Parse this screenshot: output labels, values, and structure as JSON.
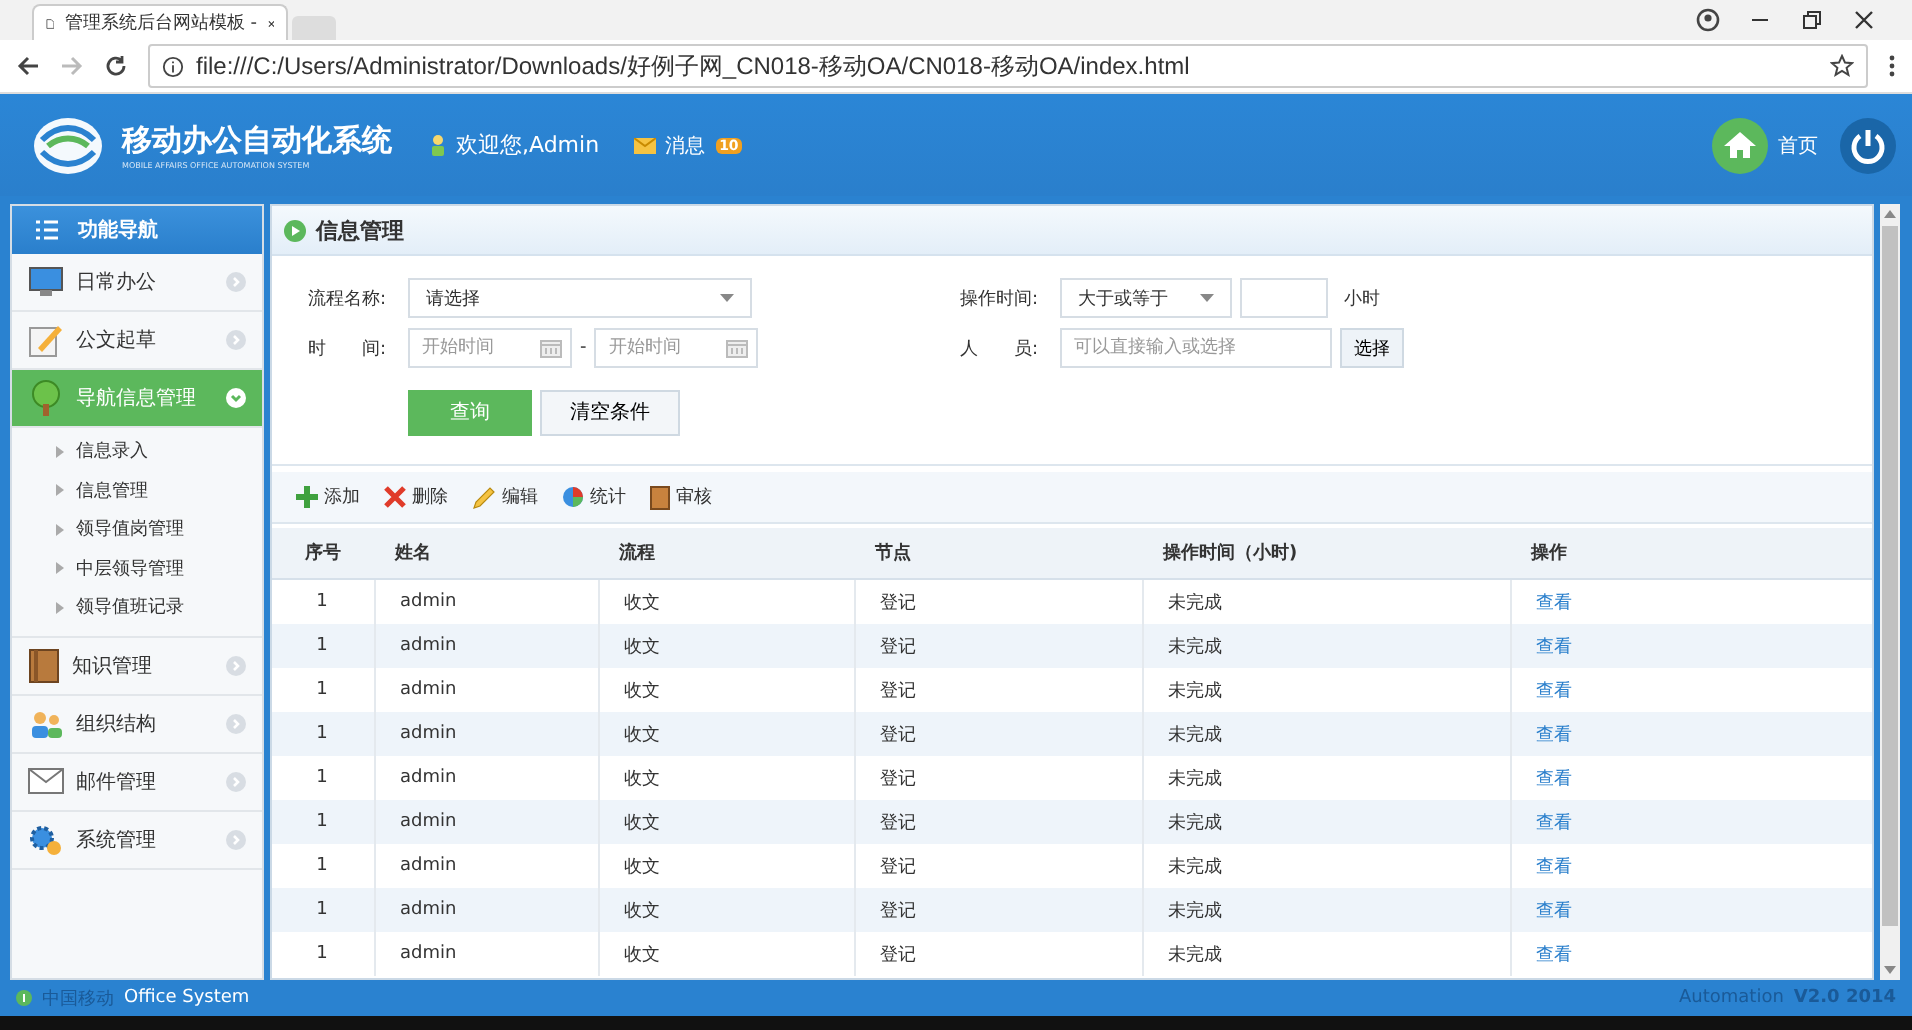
{
  "browser": {
    "tab_title": "管理系统后台网站模板 -",
    "url": "file:///C:/Users/Administrator/Downloads/好例子网_CN018-移动OA/CN018-移动OA/index.html"
  },
  "header": {
    "logo_title": "移动办公自动化系统",
    "logo_subtitle": "MOBILE AFFAIRS OFFICE AUTOMATION SYSTEM",
    "welcome": "欢迎您,Admin",
    "messages_label": "消息",
    "messages_badge": "10",
    "home_label": "首页"
  },
  "sidebar": {
    "title": "功能导航",
    "items": [
      {
        "label": "日常办公",
        "kind": "monitor",
        "expanded": false,
        "selected": false
      },
      {
        "label": "公文起草",
        "kind": "pencil",
        "expanded": false,
        "selected": false
      },
      {
        "label": "导航信息管理",
        "kind": "tree",
        "expanded": true,
        "selected": true,
        "children": [
          {
            "label": "信息录入"
          },
          {
            "label": "信息管理"
          },
          {
            "label": "领导值岗管理"
          },
          {
            "label": "中层领导管理"
          },
          {
            "label": "领导值班记录"
          }
        ]
      },
      {
        "label": "知识管理",
        "kind": "book",
        "expanded": false,
        "selected": false
      },
      {
        "label": "组织结构",
        "kind": "people",
        "expanded": false,
        "selected": false
      },
      {
        "label": "邮件管理",
        "kind": "mail",
        "expanded": false,
        "selected": false
      },
      {
        "label": "系统管理",
        "kind": "gears",
        "expanded": false,
        "selected": false
      }
    ]
  },
  "panel": {
    "title": "信息管理",
    "form": {
      "process_label": "流程名称:",
      "process_value": "请选择",
      "time_label": "时　　间:",
      "start_placeholder": "开始时间",
      "range_separator": "-",
      "end_placeholder": "开始时间",
      "op_time_label": "操作时间:",
      "op_value": "大于或等于",
      "hours_unit": "小时",
      "person_label": "人　　员:",
      "person_placeholder": "可以直接输入或选择",
      "choose_button": "选择",
      "query_button": "查询",
      "clear_button": "清空条件"
    },
    "toolbar": [
      {
        "label": "添加",
        "kind": "add"
      },
      {
        "label": "删除",
        "kind": "delete"
      },
      {
        "label": "编辑",
        "kind": "edit"
      },
      {
        "label": "统计",
        "kind": "chart"
      },
      {
        "label": "审核",
        "kind": "audit"
      }
    ],
    "table": {
      "columns": [
        "序号",
        "姓名",
        "流程",
        "节点",
        "操作时间（小时)",
        "操作"
      ],
      "rows": [
        [
          "1",
          "admin",
          "收文",
          "登记",
          "未完成",
          "查看"
        ],
        [
          "1",
          "admin",
          "收文",
          "登记",
          "未完成",
          "查看"
        ],
        [
          "1",
          "admin",
          "收文",
          "登记",
          "未完成",
          "查看"
        ],
        [
          "1",
          "admin",
          "收文",
          "登记",
          "未完成",
          "查看"
        ],
        [
          "1",
          "admin",
          "收文",
          "登记",
          "未完成",
          "查看"
        ],
        [
          "1",
          "admin",
          "收文",
          "登记",
          "未完成",
          "查看"
        ],
        [
          "1",
          "admin",
          "收文",
          "登记",
          "未完成",
          "查看"
        ],
        [
          "1",
          "admin",
          "收文",
          "登记",
          "未完成",
          "查看"
        ],
        [
          "1",
          "admin",
          "收文",
          "登记",
          "未完成",
          "查看"
        ]
      ]
    }
  },
  "footer": {
    "company": "中国移动",
    "product": "Office System",
    "right_label": "Automation",
    "version": "V2.0 2014"
  }
}
